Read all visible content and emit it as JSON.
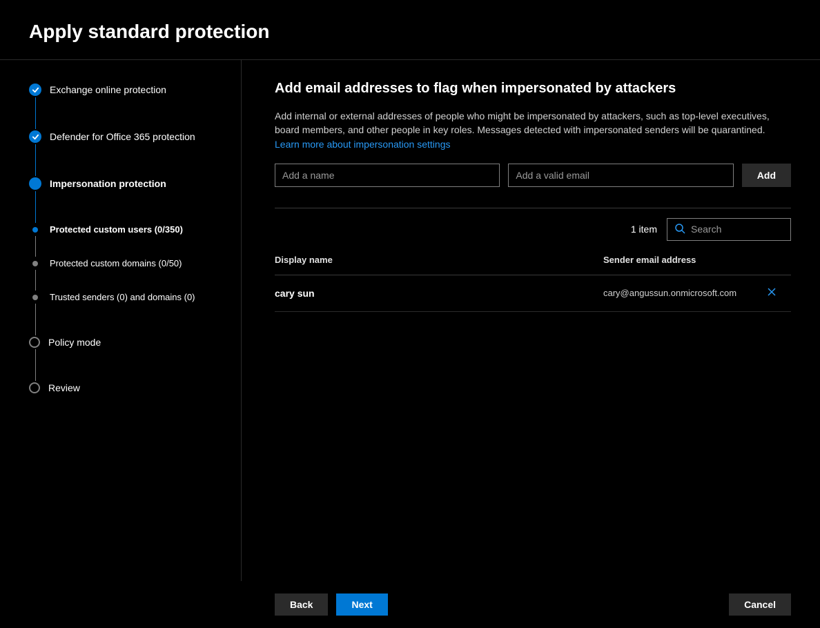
{
  "header": {
    "title": "Apply standard protection"
  },
  "sidebar": {
    "steps": [
      {
        "label": "Exchange online protection",
        "state": "completed"
      },
      {
        "label": "Defender for Office 365 protection",
        "state": "completed"
      },
      {
        "label": "Impersonation protection",
        "state": "current",
        "bold": true
      },
      {
        "label": "Protected custom users (0/350)",
        "state": "sub-current",
        "bold": true
      },
      {
        "label": "Protected custom domains (0/50)",
        "state": "sub-pending"
      },
      {
        "label": "Trusted senders (0) and domains (0)",
        "state": "sub-pending"
      },
      {
        "label": "Policy mode",
        "state": "pending"
      },
      {
        "label": "Review",
        "state": "pending"
      }
    ]
  },
  "main": {
    "heading": "Add email addresses to flag when impersonated by attackers",
    "description": "Add internal or external addresses of people who might be impersonated by attackers, such as top-level executives, board members, and other people in key roles. Messages detected with impersonated senders will be quarantined. ",
    "learn_link": "Learn more about impersonation settings",
    "name_placeholder": "Add a name",
    "email_placeholder": "Add a valid email",
    "add_button": "Add",
    "item_count": "1 item",
    "search_placeholder": "Search",
    "columns": {
      "name": "Display name",
      "email": "Sender email address"
    },
    "rows": [
      {
        "name": "cary sun",
        "email": "cary@angussun.onmicrosoft.com"
      }
    ]
  },
  "footer": {
    "back": "Back",
    "next": "Next",
    "cancel": "Cancel"
  }
}
